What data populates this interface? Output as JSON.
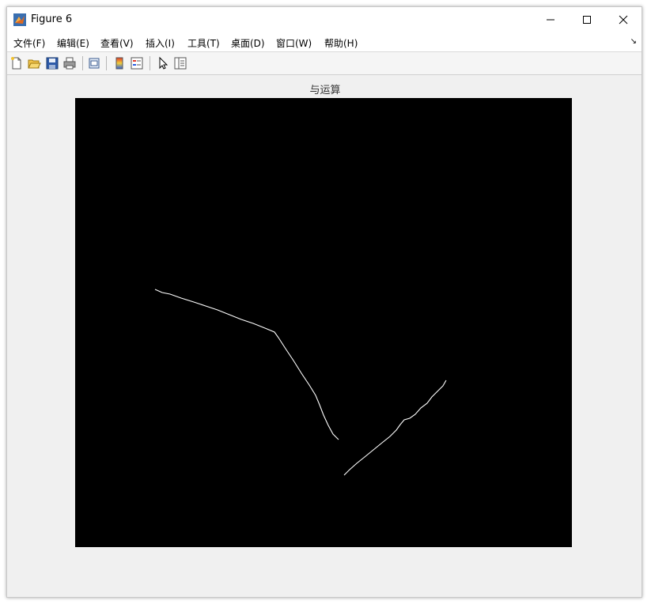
{
  "window": {
    "title": "Figure 6"
  },
  "menu": {
    "items": [
      "文件(F)",
      "编辑(E)",
      "查看(V)",
      "插入(I)",
      "工具(T)",
      "桌面(D)",
      "窗口(W)",
      "帮助(H)"
    ]
  },
  "toolbar": {
    "icons": [
      "new-figure-icon",
      "open-icon",
      "save-icon",
      "print-icon",
      "link-plot-icon",
      "colorbar-icon",
      "legend-icon",
      "select-pointer-icon",
      "property-inspector-icon"
    ]
  },
  "axes": {
    "title": "与运算",
    "background_color": "#000000",
    "line_color": "#ffffff"
  }
}
